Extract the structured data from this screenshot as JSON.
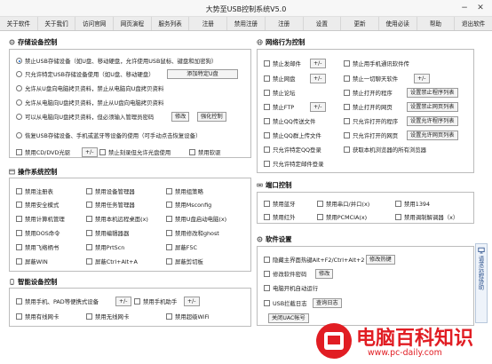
{
  "app": {
    "title": "大势至USB控制系统V5.0"
  },
  "menu": [
    "关于软件",
    "关于我们",
    "访问官网",
    "网页演程",
    "服务列表",
    "注册",
    "禁用注册",
    "注册",
    "设置",
    "更新",
    "使用必读",
    "帮助",
    "退出软件"
  ],
  "storage": {
    "title": "存储设备控制",
    "opt1": "禁止USB存储设备（如U盘、移动硬盘，允许使用USB鼠标、键盘和加密狗）",
    "opt2": "只允许特定USB存储设备使用（如U盘、移动硬盘）",
    "opt2_btn": "添加特定U盘",
    "opt3": "允许从U盘向电脑拷贝资料，禁止从电脑向U盘拷贝资料",
    "opt4": "允许从电脑向U盘拷贝资料，禁止从U盘向电脑拷贝资料",
    "opt5": "可以从电脑向U盘拷贝资料，但必须输入管理员密码",
    "opt5_btn1": "修改",
    "opt5_btn2": "强化控制",
    "opt6": "恢复USB存储设备、手机或蓝牙等设备的使用（可手动点击恢复设备）",
    "cd": "禁用CD/DVD光驱",
    "cd_btn": "+/-",
    "write": "禁止刻录但允许光盘使用",
    "floppy": "禁用软驱"
  },
  "os": {
    "title": "操作系统控制",
    "items": [
      [
        "禁用注册表",
        "禁用设备管理器",
        "禁用组策略"
      ],
      [
        "禁用安全模式",
        "禁用任务管理器",
        "禁用Msconfig"
      ],
      [
        "禁用计算机管理",
        "禁用本机远程桌面(x)",
        "禁用U盘启动电脑(x)"
      ],
      [
        "禁用DOS命令",
        "禁用编辑器器",
        "禁用修改和ghost"
      ],
      [
        "禁用飞络柄书",
        "禁用PrtScn",
        "屏蔽F5C"
      ],
      [
        "屏蔽WIN",
        "屏蔽Ctrl+Alt+A",
        "屏蔽剪切板"
      ]
    ]
  },
  "smart": {
    "title": "智能设备控制",
    "phone": "禁用手机、PAD等便携式设备",
    "phone_btn": "+/-",
    "assistant": "禁用手机助手",
    "assistant_btn": "+/-",
    "usb_nic": "禁用有线网卡",
    "wifi_nic": "禁用无线网卡",
    "wifi": "禁用超级WiFi"
  },
  "network": {
    "title": "网络行为控制",
    "left": [
      "禁止发邮件",
      "禁止网盘",
      "禁止论坛",
      "禁止FTP",
      "禁止QQ传送文件",
      "禁止QQ群上传文件",
      "只允许特定QQ登录"
    ],
    "left_btns": [
      "+/-",
      "+/-",
      "",
      "+/-",
      "",
      "",
      ""
    ],
    "right": [
      "禁止用手机通讯软件传",
      "禁止一切聊天软件",
      "禁止打开的程序",
      "禁止打开的网页",
      "只允许打开的程序",
      "只允许打开的网页",
      "获取本机浏览器的所有浏览器"
    ],
    "right_btns": [
      "",
      "+/-",
      "设置禁止程序列表",
      "设置禁止网页列表",
      "设置允许程序列表",
      "设置允许网页列表",
      ""
    ],
    "last": "只允许特定邮件登录"
  },
  "port": {
    "title": "端口控制",
    "items": [
      [
        "禁用蓝牙",
        "禁用串口/并口(x)",
        "禁用1394"
      ],
      [
        "禁用红外",
        "禁用PCMCIA(x)",
        "禁用调制解调器（x）"
      ]
    ]
  },
  "software": {
    "title": "软件设置",
    "items": [
      "隐藏主界面热键Alt+F2/Ctrl+Alt+2",
      "修改软件密码",
      "电脑开机自动运行",
      "USB拦截日志"
    ],
    "item_btns": [
      "修改热键",
      "修改",
      "",
      "查询日志"
    ],
    "uac": "关闭UAC帐号"
  },
  "sidetab": {
    "label": "请求远程协助"
  },
  "logo": {
    "name": "电脑百科知识",
    "url": "www.pc-daily.com"
  }
}
